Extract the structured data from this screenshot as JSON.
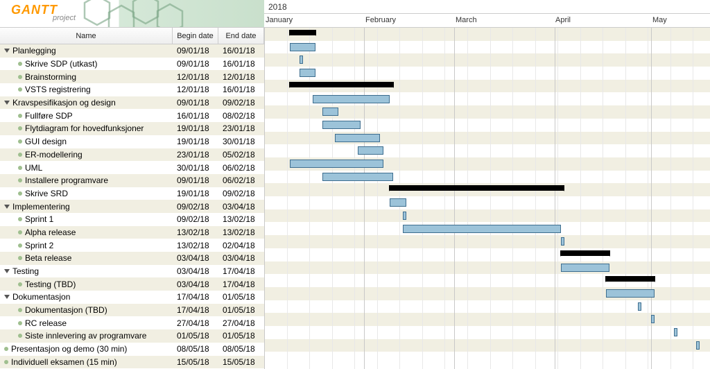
{
  "app": {
    "brand": "GANTT",
    "subbrand": "project"
  },
  "year_label": "2018",
  "columns": {
    "name": "Name",
    "begin": "Begin date",
    "end": "End date"
  },
  "months": [
    {
      "label": "January",
      "pos": 2
    },
    {
      "label": "February",
      "pos": 146
    },
    {
      "label": "March",
      "pos": 276
    },
    {
      "label": "April",
      "pos": 420
    },
    {
      "label": "May",
      "pos": 560
    }
  ],
  "colors": {
    "bar_fill": "#9cc3d9",
    "bar_stroke": "#3d6d8e",
    "stripe": "#f1efe2"
  },
  "tasks": [
    {
      "name": "Planlegging",
      "begin": "09/01/18",
      "end": "16/01/18",
      "level": 0,
      "type": "summary"
    },
    {
      "name": "Skrive SDP (utkast)",
      "begin": "09/01/18",
      "end": "16/01/18",
      "level": 1,
      "type": "task"
    },
    {
      "name": "Brainstorming",
      "begin": "12/01/18",
      "end": "12/01/18",
      "level": 1,
      "type": "task"
    },
    {
      "name": "VSTS registrering",
      "begin": "12/01/18",
      "end": "16/01/18",
      "level": 1,
      "type": "task"
    },
    {
      "name": "Kravspesifikasjon og design",
      "begin": "09/01/18",
      "end": "09/02/18",
      "level": 0,
      "type": "summary"
    },
    {
      "name": "Fullføre SDP",
      "begin": "16/01/18",
      "end": "08/02/18",
      "level": 1,
      "type": "task"
    },
    {
      "name": "Flytdiagram for hovedfunksjoner",
      "begin": "19/01/18",
      "end": "23/01/18",
      "level": 1,
      "type": "task"
    },
    {
      "name": "GUI design",
      "begin": "19/01/18",
      "end": "30/01/18",
      "level": 1,
      "type": "task"
    },
    {
      "name": "ER-modellering",
      "begin": "23/01/18",
      "end": "05/02/18",
      "level": 1,
      "type": "task"
    },
    {
      "name": "UML",
      "begin": "30/01/18",
      "end": "06/02/18",
      "level": 1,
      "type": "task"
    },
    {
      "name": "Installere programvare",
      "begin": "09/01/18",
      "end": "06/02/18",
      "level": 1,
      "type": "task"
    },
    {
      "name": "Skrive SRD",
      "begin": "19/01/18",
      "end": "09/02/18",
      "level": 1,
      "type": "task"
    },
    {
      "name": "Implementering",
      "begin": "09/02/18",
      "end": "03/04/18",
      "level": 0,
      "type": "summary"
    },
    {
      "name": "Sprint 1",
      "begin": "09/02/18",
      "end": "13/02/18",
      "level": 1,
      "type": "task"
    },
    {
      "name": "Alpha release",
      "begin": "13/02/18",
      "end": "13/02/18",
      "level": 1,
      "type": "task"
    },
    {
      "name": "Sprint 2",
      "begin": "13/02/18",
      "end": "02/04/18",
      "level": 1,
      "type": "task"
    },
    {
      "name": "Beta release",
      "begin": "03/04/18",
      "end": "03/04/18",
      "level": 1,
      "type": "task"
    },
    {
      "name": "Testing",
      "begin": "03/04/18",
      "end": "17/04/18",
      "level": 0,
      "type": "summary"
    },
    {
      "name": "Testing (TBD)",
      "begin": "03/04/18",
      "end": "17/04/18",
      "level": 1,
      "type": "task"
    },
    {
      "name": "Dokumentasjon",
      "begin": "17/04/18",
      "end": "01/05/18",
      "level": 0,
      "type": "summary"
    },
    {
      "name": "Dokumentasjon (TBD)",
      "begin": "17/04/18",
      "end": "01/05/18",
      "level": 1,
      "type": "task"
    },
    {
      "name": "RC release",
      "begin": "27/04/18",
      "end": "27/04/18",
      "level": 1,
      "type": "task"
    },
    {
      "name": "Siste innlevering av programvare",
      "begin": "01/05/18",
      "end": "01/05/18",
      "level": 1,
      "type": "task"
    },
    {
      "name": "Presentasjon og demo (30 min)",
      "begin": "08/05/18",
      "end": "08/05/18",
      "level": 0,
      "type": "task"
    },
    {
      "name": "Individuell eksamen (15 min)",
      "begin": "15/05/18",
      "end": "15/05/18",
      "level": 0,
      "type": "task"
    }
  ],
  "chart_data": {
    "type": "bar",
    "title": "",
    "x_axis": "date",
    "x_range": [
      "2018-01-01",
      "2018-05-31"
    ],
    "series": [
      {
        "name": "Planlegging",
        "start": "2018-01-09",
        "end": "2018-01-16",
        "summary": true
      },
      {
        "name": "Skrive SDP (utkast)",
        "start": "2018-01-09",
        "end": "2018-01-16"
      },
      {
        "name": "Brainstorming",
        "start": "2018-01-12",
        "end": "2018-01-12"
      },
      {
        "name": "VSTS registrering",
        "start": "2018-01-12",
        "end": "2018-01-16"
      },
      {
        "name": "Kravspesifikasjon og design",
        "start": "2018-01-09",
        "end": "2018-02-09",
        "summary": true
      },
      {
        "name": "Fullføre SDP",
        "start": "2018-01-16",
        "end": "2018-02-08"
      },
      {
        "name": "Flytdiagram for hovedfunksjoner",
        "start": "2018-01-19",
        "end": "2018-01-23"
      },
      {
        "name": "GUI design",
        "start": "2018-01-19",
        "end": "2018-01-30"
      },
      {
        "name": "ER-modellering",
        "start": "2018-01-23",
        "end": "2018-02-05"
      },
      {
        "name": "UML",
        "start": "2018-01-30",
        "end": "2018-02-06"
      },
      {
        "name": "Installere programvare",
        "start": "2018-01-09",
        "end": "2018-02-06"
      },
      {
        "name": "Skrive SRD",
        "start": "2018-01-19",
        "end": "2018-02-09"
      },
      {
        "name": "Implementering",
        "start": "2018-02-09",
        "end": "2018-04-03",
        "summary": true
      },
      {
        "name": "Sprint 1",
        "start": "2018-02-09",
        "end": "2018-02-13"
      },
      {
        "name": "Alpha release",
        "start": "2018-02-13",
        "end": "2018-02-13"
      },
      {
        "name": "Sprint 2",
        "start": "2018-02-13",
        "end": "2018-04-02"
      },
      {
        "name": "Beta release",
        "start": "2018-04-03",
        "end": "2018-04-03"
      },
      {
        "name": "Testing",
        "start": "2018-04-03",
        "end": "2018-04-17",
        "summary": true
      },
      {
        "name": "Testing (TBD)",
        "start": "2018-04-03",
        "end": "2018-04-17"
      },
      {
        "name": "Dokumentasjon",
        "start": "2018-04-17",
        "end": "2018-05-01",
        "summary": true
      },
      {
        "name": "Dokumentasjon (TBD)",
        "start": "2018-04-17",
        "end": "2018-05-01"
      },
      {
        "name": "RC release",
        "start": "2018-04-27",
        "end": "2018-04-27"
      },
      {
        "name": "Siste innlevering av programvare",
        "start": "2018-05-01",
        "end": "2018-05-01"
      },
      {
        "name": "Presentasjon og demo (30 min)",
        "start": "2018-05-08",
        "end": "2018-05-08"
      },
      {
        "name": "Individuell eksamen (15 min)",
        "start": "2018-05-15",
        "end": "2018-05-15"
      }
    ]
  }
}
